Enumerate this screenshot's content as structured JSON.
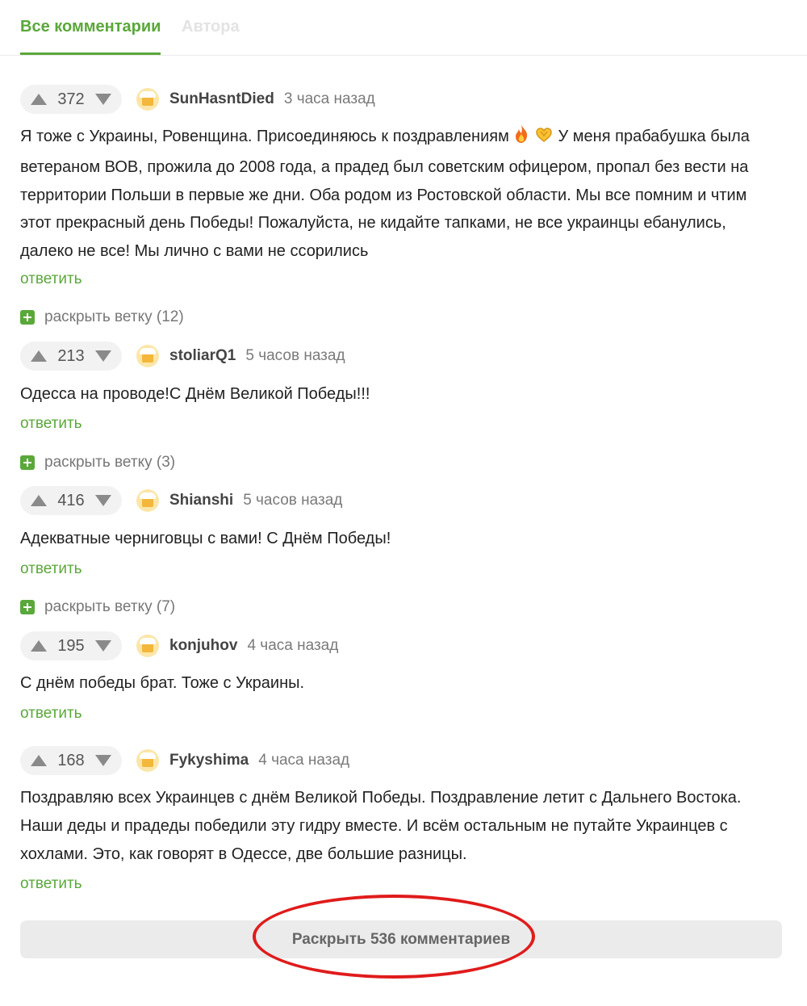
{
  "tabs": {
    "all_comments": "Все комментарии",
    "authors": "Автора"
  },
  "comments": [
    {
      "rating": "372",
      "author": "SunHasntDied",
      "time": "3 часа назад",
      "text_lines": [
        "Я тоже с Украины, Ровенщина. Присоединяюсь к поздравлениям",
        "ветераном ВОВ, прожила до 2008 года, а прадед был советским офицером, пропал без вести на",
        "территории Польши в первые же дни. Оба родом из Ростовской области. Мы все помним и чтим",
        "этот прекрасный день Победы! Пожалуйста, не кидайте тапками, не все украинцы ебанулись,",
        "далеко не все! Мы лично с вами не ссорились"
      ],
      "text_line1_tail": "У меня прабабушка была",
      "emojis": [
        "fire-emoji",
        "heart-hands-emoji"
      ],
      "reply": "ответить",
      "expand_thread": "раскрыть ветку (12)"
    },
    {
      "rating": "213",
      "author": "stoliarQ1",
      "time": "5 часов назад",
      "text": "Одесса на проводе!С Днём Великой Победы!!!",
      "reply": "ответить",
      "expand_thread": "раскрыть ветку (3)"
    },
    {
      "rating": "416",
      "author": "Shianshi",
      "time": "5 часов назад",
      "text": "Адекватные черниговцы с вами! С Днём Победы!",
      "reply": "ответить",
      "expand_thread": "раскрыть ветку (7)"
    },
    {
      "rating": "195",
      "author": "konjuhov",
      "time": "4 часа назад",
      "text": "С днём победы брат. Тоже с Украины.",
      "reply": "ответить"
    },
    {
      "rating": "168",
      "author": "Fykyshima",
      "time": "4 часа назад",
      "text_lines": [
        "Поздравляю всех Украинцев с днём Великой Победы. Поздравление летит с Дальнего Востока.",
        "Наши деды и прадеды победили эту гидру вместе. И всём остальным не путайте Украинцев с",
        "хохлами. Это, как говорят в Одессе, две большие разницы."
      ],
      "reply": "ответить"
    }
  ],
  "load_more": "Раскрыть 536 комментариев",
  "colors": {
    "accent": "#5aa83a",
    "highlight": "#e01b1b"
  }
}
